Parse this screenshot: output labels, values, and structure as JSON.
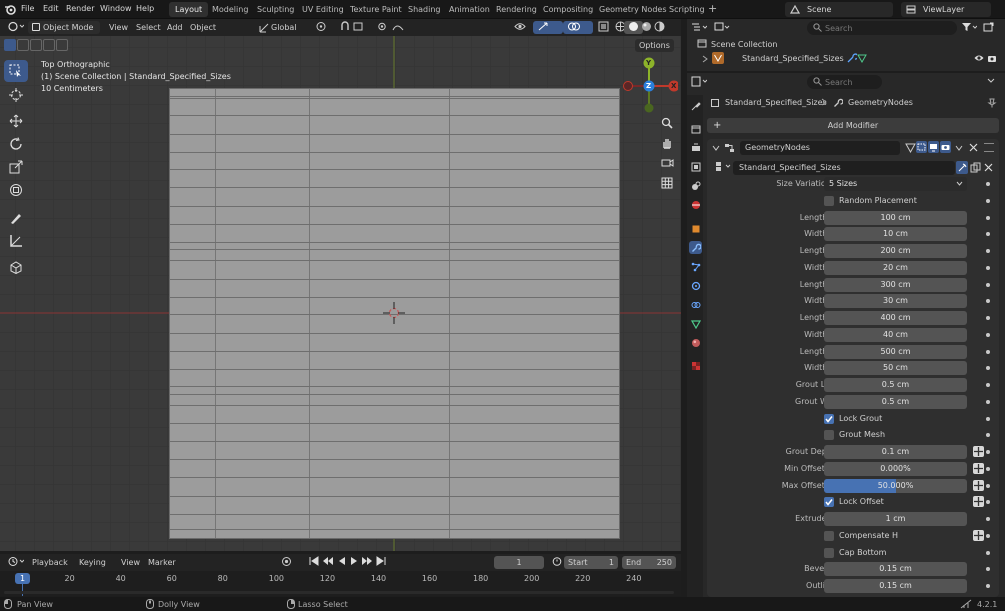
{
  "menu": {
    "file": "File",
    "edit": "Edit",
    "render": "Render",
    "window": "Window",
    "help": "Help"
  },
  "workspaces": [
    "Layout",
    "Modeling",
    "Sculpting",
    "UV Editing",
    "Texture Paint",
    "Shading",
    "Animation",
    "Rendering",
    "Compositing",
    "Geometry Nodes",
    "Scripting"
  ],
  "scene": {
    "name": "Scene",
    "view_layer": "ViewLayer"
  },
  "viewport": {
    "mode": "Object Mode",
    "view": "View",
    "select": "Select",
    "add": "Add",
    "object": "Object",
    "orientation": "Global",
    "options": "Options",
    "info_line1": "Top Orthographic",
    "info_line2": "(1) Scene Collection | Standard_Specified_Sizes",
    "info_line3": "10 Centimeters",
    "gizmo_x": "X",
    "gizmo_y": "Y",
    "gizmo_z": "Z"
  },
  "outliner": {
    "search_placeholder": "Search",
    "collection": "Scene Collection",
    "object": "Standard_Specified_Sizes"
  },
  "properties": {
    "search_placeholder": "Search",
    "breadcrumb_object": "Standard_Specified_Sizes",
    "breadcrumb_modifier": "GeometryNodes",
    "add_modifier": "Add Modifier",
    "modifier_name": "GeometryNodes",
    "node_group": "Standard_Specified_Sizes",
    "fields": [
      {
        "type": "dropdown",
        "label": "Size Variations",
        "value": "5 Sizes"
      },
      {
        "type": "check",
        "label": "Random Placement",
        "checked": false
      },
      {
        "type": "value",
        "label": "Length 1",
        "value": "100 cm"
      },
      {
        "type": "value",
        "label": "Width 1",
        "value": "10 cm"
      },
      {
        "type": "value",
        "label": "Length 2",
        "value": "200 cm"
      },
      {
        "type": "value",
        "label": "Width 2",
        "value": "20 cm"
      },
      {
        "type": "value",
        "label": "Length 3",
        "value": "300 cm"
      },
      {
        "type": "value",
        "label": "Width 3",
        "value": "30 cm"
      },
      {
        "type": "value",
        "label": "Length 4",
        "value": "400 cm"
      },
      {
        "type": "value",
        "label": "Width 4",
        "value": "40 cm"
      },
      {
        "type": "value",
        "label": "Length 5",
        "value": "500 cm"
      },
      {
        "type": "value",
        "label": "Width 5",
        "value": "50 cm"
      },
      {
        "type": "value",
        "label": "Grout Len",
        "value": "0.5 cm"
      },
      {
        "type": "value",
        "label": "Grout Wid",
        "value": "0.5 cm"
      },
      {
        "type": "check",
        "label": "Lock Grout",
        "checked": true
      },
      {
        "type": "check",
        "label": "Grout Mesh",
        "checked": false
      },
      {
        "type": "value",
        "label": "Grout Depth",
        "value": "0.1 cm",
        "icon": true
      },
      {
        "type": "value",
        "label": "Min Offset %",
        "value": "0.000%",
        "icon": true
      },
      {
        "type": "slider",
        "label": "Max Offset %",
        "value": "50.000%",
        "fraction": 0.5,
        "icon": true
      },
      {
        "type": "check",
        "label": "Lock Offset",
        "checked": true,
        "icon": true
      },
      {
        "type": "value",
        "label": "Extrude H",
        "value": "1 cm"
      },
      {
        "type": "check",
        "label": "Compensate H",
        "checked": false,
        "icon": true
      },
      {
        "type": "check",
        "label": "Cap Bottom",
        "checked": false
      },
      {
        "type": "value",
        "label": "Bevel H",
        "value": "0.15 cm"
      },
      {
        "type": "value",
        "label": "Outline",
        "value": "0.15 cm"
      }
    ]
  },
  "timeline": {
    "playback": "Playback",
    "keying": "Keying",
    "view": "View",
    "marker": "Marker",
    "current_frame": "1",
    "start_label": "Start",
    "start": "1",
    "end_label": "End",
    "end": "250",
    "ticks": [
      "20",
      "40",
      "60",
      "80",
      "100",
      "120",
      "140",
      "160",
      "180",
      "200",
      "220",
      "240"
    ],
    "playhead": "1"
  },
  "status": {
    "pan": "Pan View",
    "dolly": "Dolly View",
    "lasso": "Lasso Select",
    "version": "4.2.1"
  },
  "colors": {
    "accent": "#4772b3",
    "x_axis": "#c0392b",
    "y_axis": "#8db32a",
    "z_axis": "#2a7fdb"
  }
}
